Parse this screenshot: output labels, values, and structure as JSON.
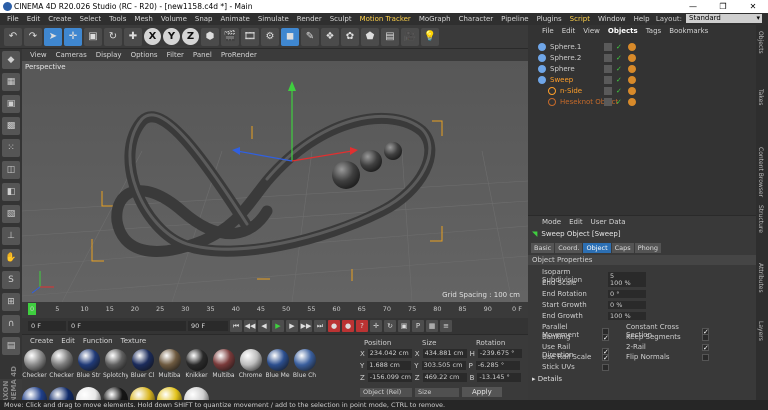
{
  "titlebar": {
    "title": "CINEMA 4D R20.026 Studio (RC - R20) - [new1158.c4d *] - Main",
    "minimize": "—",
    "maximize": "❐",
    "close": "✕"
  },
  "menubar": {
    "items": [
      "File",
      "Edit",
      "Create",
      "Select",
      "Tools",
      "Mesh",
      "Volume",
      "Snap",
      "Animate",
      "Simulate",
      "Render",
      "Sculpt",
      "Motion Tracker",
      "MoGraph",
      "Character",
      "Pipeline",
      "Plugins",
      "Script",
      "Window",
      "Help"
    ],
    "highlight": [
      "Motion Tracker",
      "Script"
    ],
    "layout_label": "Layout:",
    "layout_value": "Standard"
  },
  "toolbar": {
    "axis_x": "X",
    "axis_y": "Y",
    "axis_z": "Z"
  },
  "viewport": {
    "menu": [
      "View",
      "Cameras",
      "Display",
      "Options",
      "Filter",
      "Panel",
      "ProRender"
    ],
    "label": "Perspective",
    "grid_spacing": "Grid Spacing : 100 cm"
  },
  "timeline": {
    "ticks": [
      "0",
      "5",
      "10",
      "15",
      "20",
      "25",
      "30",
      "35",
      "40",
      "45",
      "50",
      "55",
      "60",
      "65",
      "70",
      "75",
      "80",
      "85",
      "90"
    ],
    "end_tick": "0 F",
    "start_frame": "0 F",
    "current_frame": "0 F",
    "end_frame": "90 F",
    "max_frame": "90 F"
  },
  "materials": {
    "menu": [
      "Create",
      "Edit",
      "Function",
      "Texture"
    ],
    "items": [
      {
        "name": "Checker",
        "color": "#8a8a8a"
      },
      {
        "name": "Checker",
        "color": "#7d7d7d"
      },
      {
        "name": "Blue Str",
        "color": "#203a78"
      },
      {
        "name": "Splotchy",
        "color": "#5f5f5f"
      },
      {
        "name": "Bluer Cl",
        "color": "#1b2b5c"
      },
      {
        "name": "Multiba",
        "color": "#6e5a40"
      },
      {
        "name": "Knikker",
        "color": "#2a2a2a"
      },
      {
        "name": "Multiba",
        "color": "#7a3a3a"
      },
      {
        "name": "Chrome",
        "color": "#bdbdbd"
      },
      {
        "name": "Blue Me",
        "color": "#2c4f8f"
      },
      {
        "name": "Blue Ch",
        "color": "#3a5f9e"
      },
      {
        "name": "",
        "color": "#1f3f8a"
      },
      {
        "name": "",
        "color": "#0f2a6a"
      },
      {
        "name": "",
        "color": "#e8e8e8"
      },
      {
        "name": "",
        "color": "#141414"
      },
      {
        "name": "",
        "color": "#d9b51f"
      },
      {
        "name": "",
        "color": "#e2c21a"
      },
      {
        "name": "",
        "color": "#cfcfcf"
      }
    ]
  },
  "coords": {
    "headers": [
      "Position",
      "Size",
      "Rotation"
    ],
    "rows": [
      {
        "axis": "X",
        "pos": "234.042 cm",
        "size": "434.881 cm",
        "rot_axis": "H",
        "rot": "-239.675 °"
      },
      {
        "axis": "Y",
        "pos": "1.688 cm",
        "size": "303.505 cm",
        "rot_axis": "P",
        "rot": "-6.285 °"
      },
      {
        "axis": "Z",
        "pos": "-156.099 cm",
        "size": "469.22 cm",
        "rot_axis": "B",
        "rot": "-13.145 °"
      }
    ],
    "mode": "Object (Rel)",
    "size_mode": "Size",
    "apply": "Apply"
  },
  "objects": {
    "menu": [
      "File",
      "Edit",
      "View",
      "Objects",
      "Tags",
      "Bookmarks"
    ],
    "active": "Objects",
    "items": [
      {
        "name": "Sphere.1",
        "indent": 0,
        "color": "#cfcfcf"
      },
      {
        "name": "Sphere.2",
        "indent": 0,
        "color": "#cfcfcf"
      },
      {
        "name": "Sphere",
        "indent": 0,
        "color": "#cfcfcf"
      },
      {
        "name": "Sweep",
        "indent": 0,
        "color": "#ff9f2a"
      },
      {
        "name": "n-Side",
        "indent": 1,
        "color": "#ff9f2a"
      },
      {
        "name": "Heseknot Object",
        "indent": 1,
        "color": "#c56a2a"
      }
    ]
  },
  "attributes": {
    "menu": [
      "Mode",
      "Edit",
      "User Data"
    ],
    "title": "Sweep Object [Sweep]",
    "tabs": [
      "Basic",
      "Coord.",
      "Object",
      "Caps",
      "Phong"
    ],
    "active_tab": "Object",
    "section": "Object Properties",
    "fields": [
      {
        "label": "Isoparm Subdivision",
        "value": "5"
      },
      {
        "label": "End Scale",
        "value": "100 %"
      },
      {
        "label": "End Rotation",
        "value": "0 °"
      },
      {
        "label": "Start Growth",
        "value": "0 %"
      },
      {
        "label": "End Growth",
        "value": "100 %"
      }
    ],
    "checks_left": [
      {
        "label": "Parallel Movement",
        "checked": ""
      },
      {
        "label": "Banking",
        "checked": "✓"
      },
      {
        "label": "Use Rail Direction",
        "checked": "✓"
      },
      {
        "label": "Use Rail Scale",
        "checked": "✓"
      },
      {
        "label": "Stick UVs",
        "checked": ""
      }
    ],
    "checks_right": [
      {
        "label": "Constant Cross Section",
        "checked": "✓"
      },
      {
        "label": "Keep Segments",
        "checked": ""
      },
      {
        "label": "2-Rail",
        "checked": "✓"
      },
      {
        "label": "Flip Normals",
        "checked": ""
      }
    ],
    "details": "Details"
  },
  "rightstrip": [
    "Objects",
    "Takes",
    "Content Browser",
    "Structure",
    "Attributes",
    "Layers"
  ],
  "brand": "MAXON CINEMA 4D",
  "statusbar": "Move: Click and drag to move elements. Hold down SHIFT to quantize movement / add to the selection in point mode, CTRL to remove."
}
